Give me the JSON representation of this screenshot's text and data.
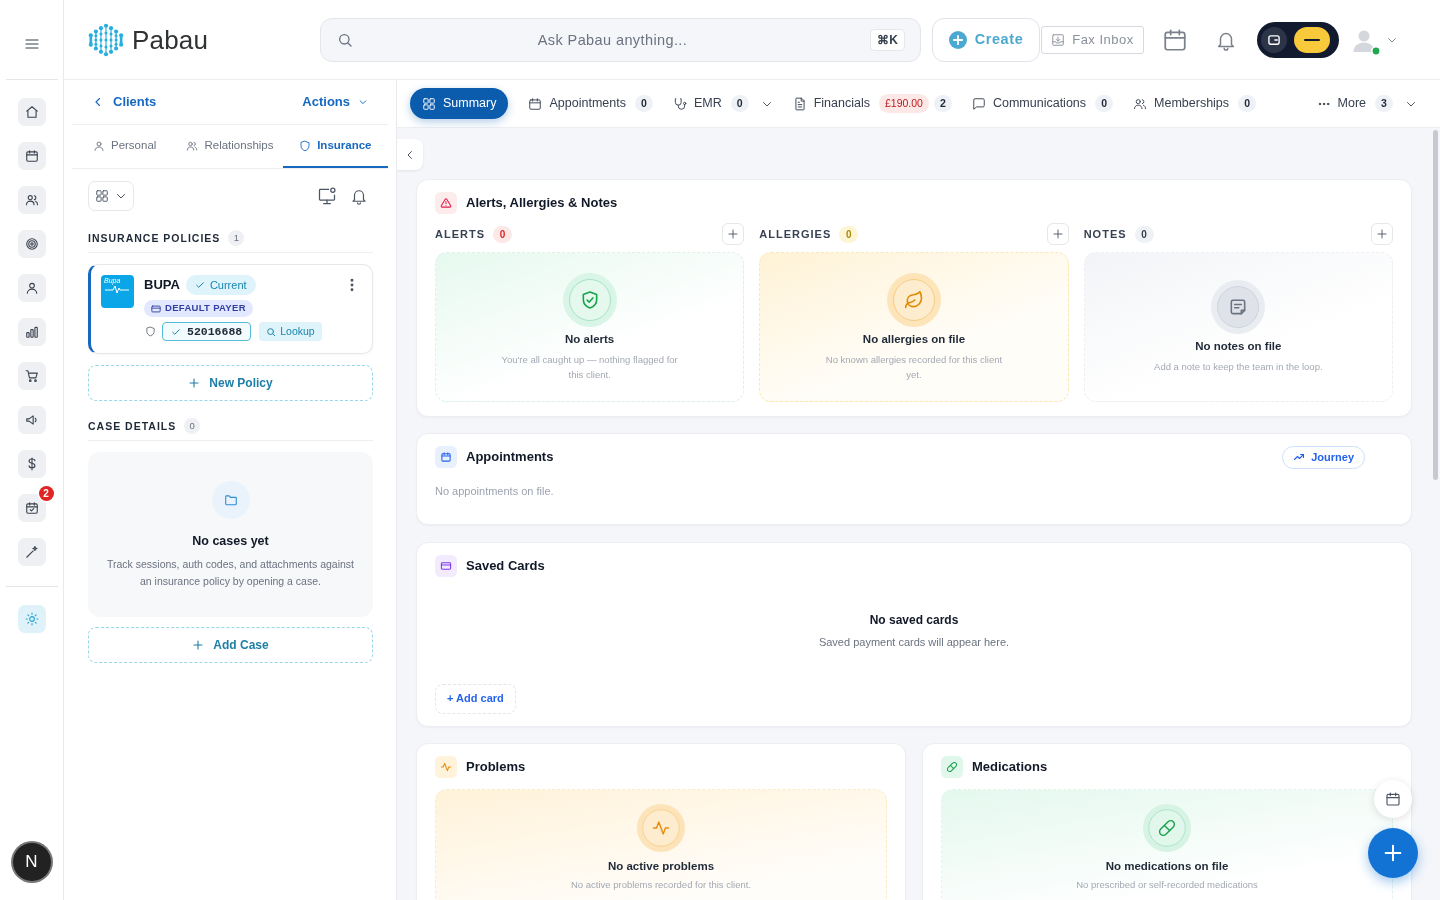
{
  "rail": {
    "items": [
      {
        "selected": false
      },
      {
        "selected": false
      },
      {
        "selected": false
      },
      {
        "selected": false
      },
      {
        "selected": false
      },
      {
        "selected": false
      },
      {
        "selected": false
      },
      {
        "selected": false
      },
      {
        "selected": false
      },
      {
        "selected": false,
        "badge": "2"
      },
      {
        "selected": false
      }
    ],
    "pinned": [
      {
        "selected": true
      }
    ],
    "user_initial": "N"
  },
  "header": {
    "logo_text": "Pabau",
    "search": {
      "placeholder": "Ask Pabau anything...",
      "shortcut": "⌘K"
    },
    "create_label": "Create",
    "fax_label": "Fax Inbox",
    "quick_toggle": {
      "on": true
    },
    "user": {
      "online": true
    }
  },
  "client_panel": {
    "back_label": "Clients",
    "actions_label": "Actions",
    "tabs": [
      {
        "label": "Personal",
        "selected": false
      },
      {
        "label": "Relationships",
        "selected": false
      },
      {
        "label": "Insurance",
        "selected": true
      }
    ],
    "view_toggle": {
      "expanded": false
    },
    "policies_section": {
      "title": "INSURANCE POLICIES",
      "count": "1",
      "policies": [
        {
          "logo_text": "Bupa",
          "name": "BUPA",
          "status": "Current",
          "payer_tag": "DEFAULT PAYER",
          "member_number": "52016688",
          "member_verified": true,
          "lookup_label": "Lookup"
        }
      ],
      "add_label": "New Policy"
    },
    "cases_section": {
      "title": "CASE DETAILS",
      "count": "0",
      "empty_title": "No cases yet",
      "empty_text": "Track sessions, auth codes, and attachments against an insurance policy by opening a case.",
      "add_label": "Add Case"
    }
  },
  "tabs": [
    {
      "label": "Summary",
      "selected": true,
      "dropdown": false
    },
    {
      "label": "Appointments",
      "count": "0",
      "selected": false,
      "dropdown": false
    },
    {
      "label": "EMR",
      "count": "0",
      "selected": false,
      "dropdown": true
    },
    {
      "label": "Financials",
      "amount": "£190.00",
      "count": "2",
      "selected": false,
      "dropdown": false
    },
    {
      "label": "Communications",
      "count": "0",
      "selected": false,
      "dropdown": false
    },
    {
      "label": "Memberships",
      "count": "0",
      "selected": false,
      "dropdown": false
    },
    {
      "label": "More",
      "count": "3",
      "selected": false,
      "dropdown": true
    }
  ],
  "alerts_card": {
    "title": "Alerts, Allergies & Notes",
    "columns": [
      {
        "kind": "alert",
        "label": "ALERTS",
        "count": "0",
        "empty_title": "No alerts",
        "empty_text": "You're all caught up — nothing flagged for this client."
      },
      {
        "kind": "allergy",
        "label": "ALLERGIES",
        "count": "0",
        "empty_title": "No allergies on file",
        "empty_text": "No known allergies recorded for this client yet."
      },
      {
        "kind": "note",
        "label": "NOTES",
        "count": "0",
        "empty_title": "No notes on file",
        "empty_text": "Add a note to keep the team in the loop."
      }
    ]
  },
  "appointments_card": {
    "title": "Appointments",
    "journey_label": "Journey",
    "empty_text": "No appointments on file."
  },
  "saved_cards": {
    "title": "Saved Cards",
    "empty_title": "No saved cards",
    "empty_text": "Saved payment cards will appear here.",
    "add_label": "+ Add card"
  },
  "clinical_cards": [
    {
      "kind": "problem",
      "title": "Problems",
      "empty_title": "No active problems",
      "empty_text": "No active problems recorded for this client."
    },
    {
      "kind": "medication",
      "title": "Medications",
      "empty_title": "No medications on file",
      "empty_text": "No prescribed or self-recorded medications"
    }
  ]
}
